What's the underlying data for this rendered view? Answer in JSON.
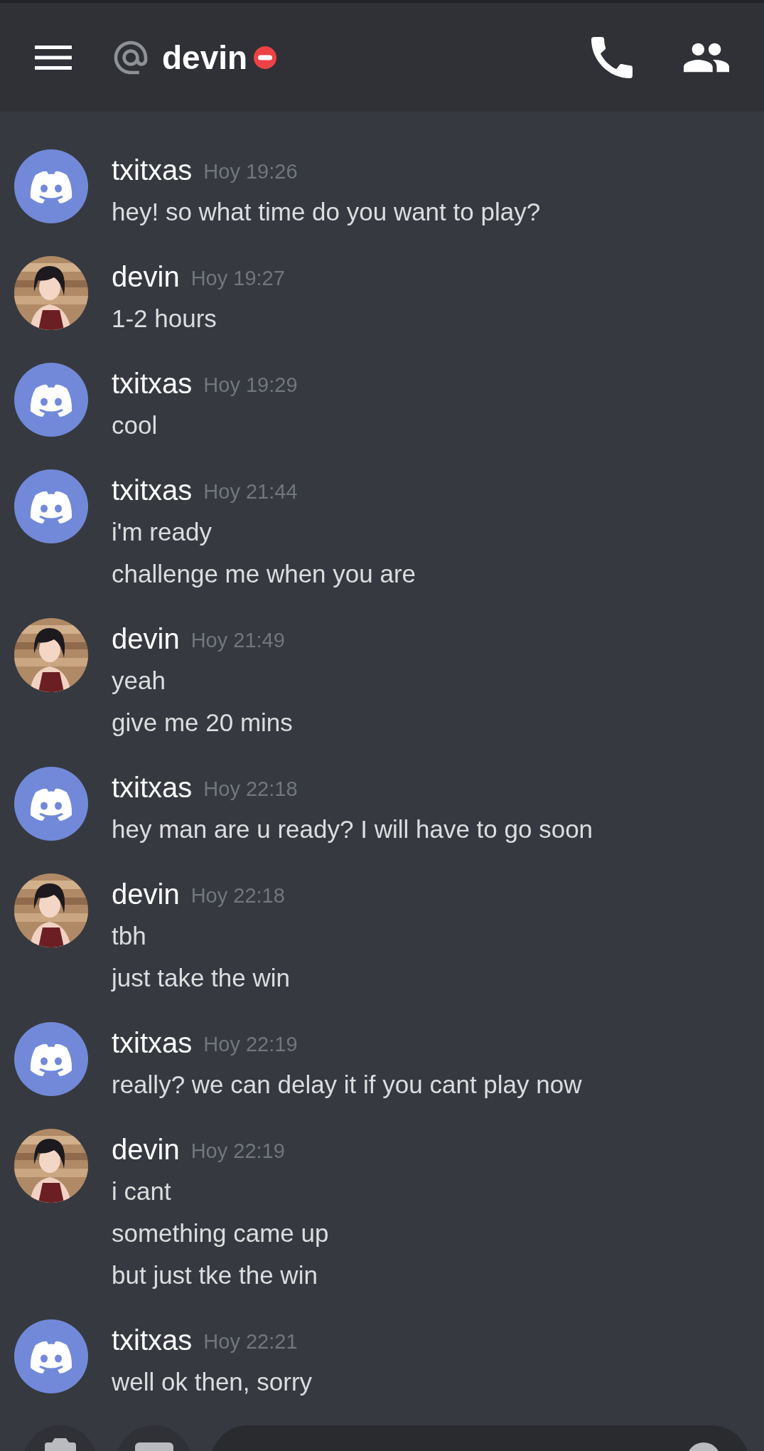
{
  "header": {
    "title": "devin",
    "status": {
      "kind": "dnd"
    }
  },
  "messages": [
    {
      "author": "txitxas",
      "time": "Hoy 19:26",
      "avatar": {
        "kind": "default"
      },
      "lines": [
        "hey! so what time do you want to play?"
      ]
    },
    {
      "author": "devin",
      "time": "Hoy 19:27",
      "avatar": {
        "kind": "picture"
      },
      "lines": [
        "1-2 hours"
      ]
    },
    {
      "author": "txitxas",
      "time": "Hoy 19:29",
      "avatar": {
        "kind": "default"
      },
      "lines": [
        "cool"
      ]
    },
    {
      "author": "txitxas",
      "time": "Hoy 21:44",
      "avatar": {
        "kind": "default"
      },
      "lines": [
        "i'm ready",
        "challenge me when you are"
      ]
    },
    {
      "author": "devin",
      "time": "Hoy 21:49",
      "avatar": {
        "kind": "picture"
      },
      "lines": [
        "yeah",
        "give me 20 mins"
      ]
    },
    {
      "author": "txitxas",
      "time": "Hoy 22:18",
      "avatar": {
        "kind": "default"
      },
      "lines": [
        "hey man are u ready? I will have to go soon"
      ]
    },
    {
      "author": "devin",
      "time": "Hoy 22:18",
      "avatar": {
        "kind": "picture"
      },
      "lines": [
        "tbh",
        "just take the win"
      ]
    },
    {
      "author": "txitxas",
      "time": "Hoy 22:19",
      "avatar": {
        "kind": "default"
      },
      "lines": [
        "really? we can delay it if you cant play now"
      ]
    },
    {
      "author": "devin",
      "time": "Hoy 22:19",
      "avatar": {
        "kind": "picture"
      },
      "lines": [
        "i cant",
        "something came up",
        "but just tke the win"
      ]
    },
    {
      "author": "txitxas",
      "time": "Hoy 22:21",
      "avatar": {
        "kind": "default"
      },
      "lines": [
        "well ok then, sorry"
      ]
    }
  ]
}
